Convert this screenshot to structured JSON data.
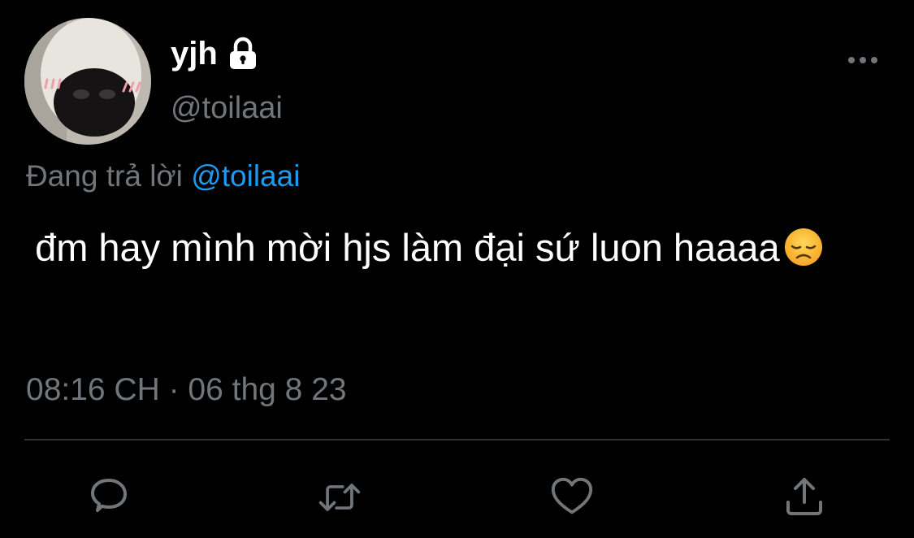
{
  "author": {
    "display_name": "yjh",
    "username": "@toilaai",
    "protected_icon": "lock-icon",
    "avatar": "dog-nose-closeup-avatar"
  },
  "reply_context": {
    "prefix": "Đang trả lời ",
    "mention": "@toilaai"
  },
  "tweet": {
    "text": " đm hay mình mời hjs làm đại sứ luon haaaa",
    "emoji": "disappointed-face-emoji",
    "timestamp": "08:16 CH · 06 thg 8 23"
  },
  "header": {
    "more_icon": "more-options-icon"
  },
  "actions": [
    {
      "name": "reply",
      "icon": "reply-icon"
    },
    {
      "name": "retweet",
      "icon": "retweet-icon"
    },
    {
      "name": "like",
      "icon": "heart-icon"
    },
    {
      "name": "share",
      "icon": "share-icon"
    }
  ],
  "colors": {
    "background": "#000000",
    "primary_text": "#ffffff",
    "secondary_text": "#71767b",
    "accent": "#1d9bf0",
    "divider": "#2f3336"
  }
}
